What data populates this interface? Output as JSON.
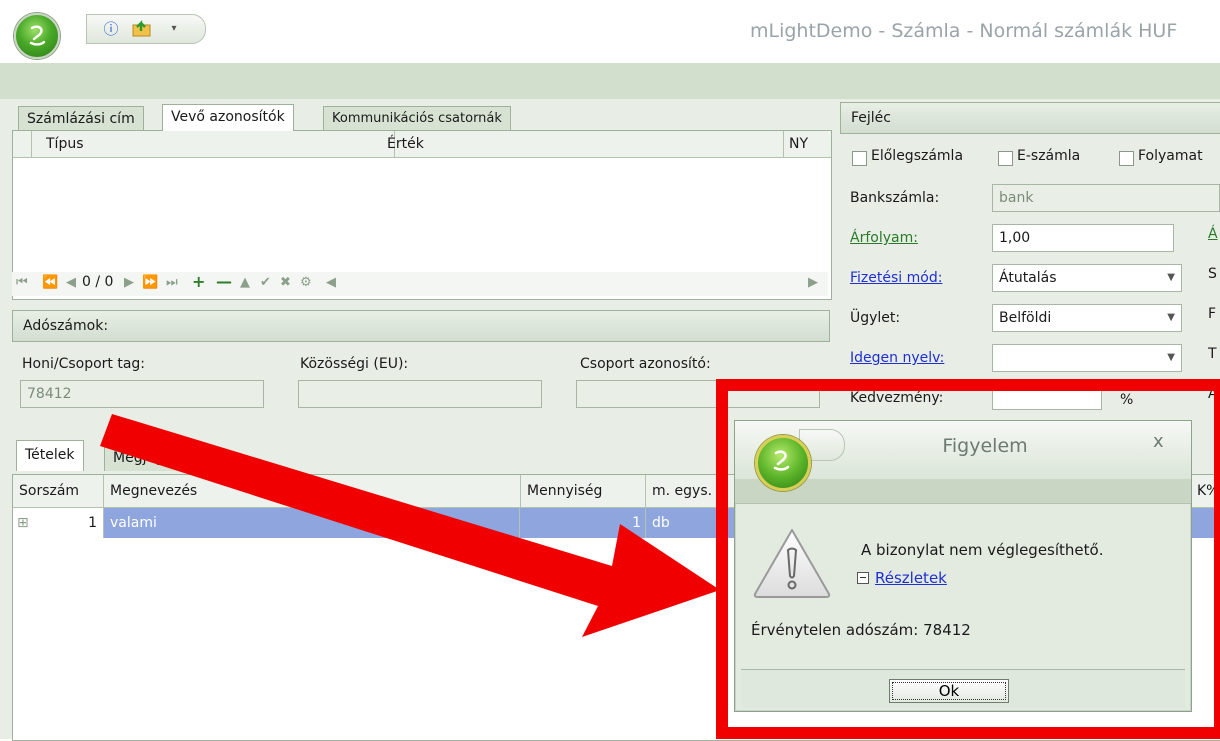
{
  "app": {
    "title": "mLightDemo - Számla - Normál számlák HUF"
  },
  "top_tabs": [
    {
      "label": "Számlázási cím"
    },
    {
      "label": "Vevő azonosítók"
    },
    {
      "label": "Kommunikációs csatornák"
    }
  ],
  "ids_grid": {
    "columns": [
      "Típus",
      "Érték",
      "NY"
    ],
    "navigator": {
      "position": "0 / 0"
    }
  },
  "tax": {
    "section": "Adószámok:",
    "honi_label": "Honi/Csoport tag:",
    "honi_value": "78412",
    "eu_label": "Közösségi (EU):",
    "group_label": "Csoport azonosító:"
  },
  "header": {
    "section": "Fejléc",
    "checkboxes": [
      "Előlegszámla",
      "E-számla",
      "Folyamat"
    ],
    "bank_label": "Bankszámla:",
    "bank_value": "bank",
    "rate_label": "Árfolyam:",
    "rate_value": "1,00",
    "payment_label": "Fizetési mód:",
    "payment_value": "Átutalás",
    "deal_label": "Ügylet:",
    "deal_value": "Belföldi",
    "lang_label": "Idegen nyelv:",
    "lang_value": "",
    "discount_label": "Kedvezmény:",
    "discount_unit": "%",
    "cut_letters": [
      "Á",
      "S",
      "F",
      "T",
      "Á"
    ]
  },
  "bottom_tabs": [
    {
      "label": "Tételek"
    },
    {
      "label": "Megjegyzés"
    }
  ],
  "items": {
    "columns": [
      "Sorszám",
      "Megnevezés",
      "Mennyiség",
      "m. egys.",
      "K%"
    ],
    "rows": [
      {
        "num": "1",
        "name": "valami",
        "qty": "1",
        "unit": "db"
      }
    ]
  },
  "dialog": {
    "title": "Figyelem",
    "close": "x",
    "message": "A bizonylat nem véglegesíthető.",
    "details_label": "Részletek",
    "error": "Érvénytelen adószám: 78412",
    "ok_label": "Ok"
  },
  "colors": {
    "highlight": "#f00000",
    "selection": "#8ea6dd",
    "link": "#1f2fd1"
  }
}
